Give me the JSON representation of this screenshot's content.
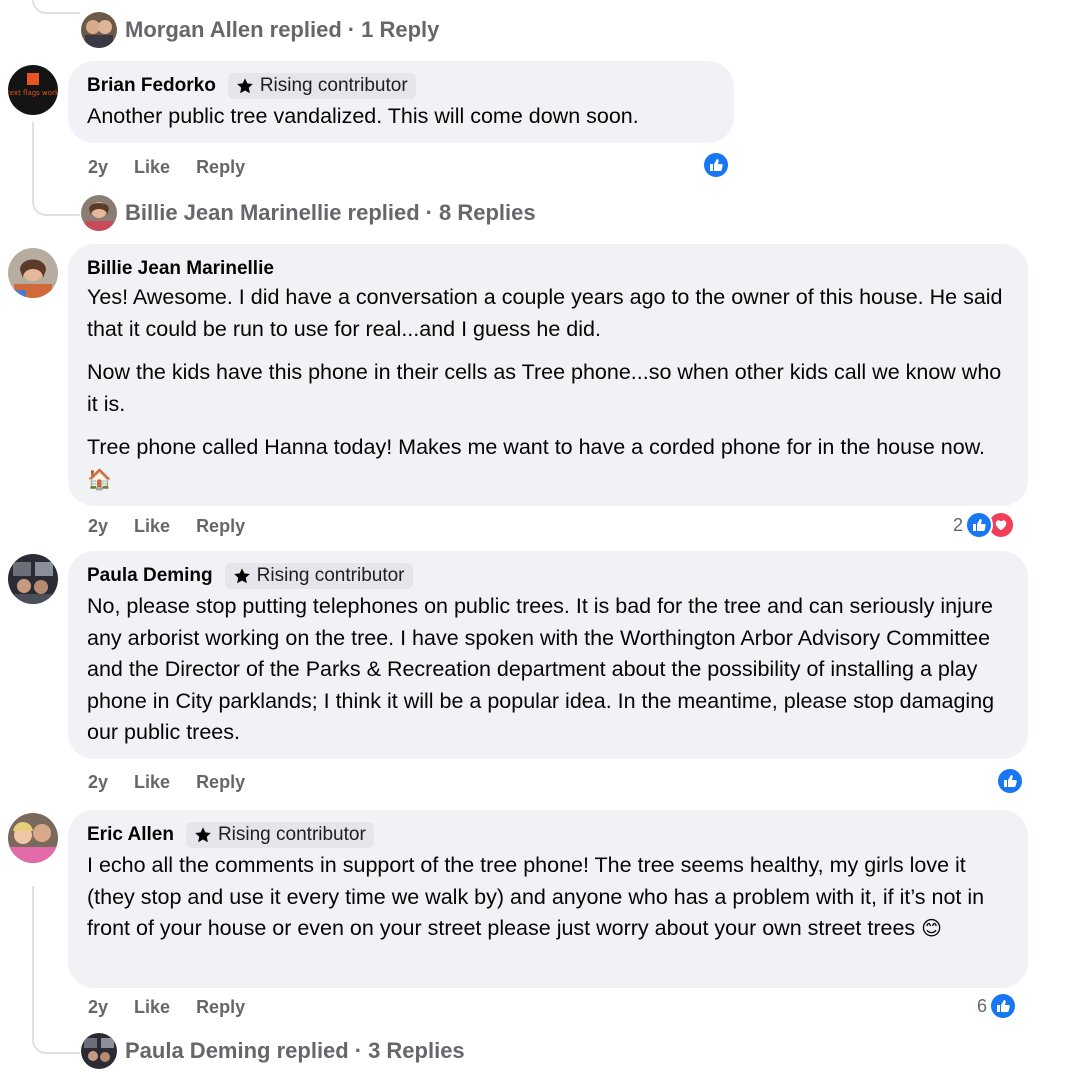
{
  "threads": {
    "morgan": {
      "replied": "Morgan Allen replied",
      "count": "1 Reply"
    },
    "billie": {
      "replied": "Billie Jean Marinellie replied",
      "count": "8 Replies"
    },
    "paula": {
      "replied": "Paula Deming replied",
      "count": "3 Replies"
    }
  },
  "separator": "·",
  "comments": [
    {
      "author": "Brian Fedorko",
      "badge": "Rising contributor",
      "avatar_text": "text flags work",
      "paragraphs": [
        "Another public tree vandalized. This will come down soon."
      ],
      "time": "2y",
      "like": "Like",
      "reply": "Reply",
      "reaction_count": ""
    },
    {
      "author": "Billie Jean Marinellie",
      "paragraphs": [
        "Yes! Awesome. I did have a conversation a couple years ago to the owner of this house. He said that it could be run to use for real...and I guess he did.",
        "Now the kids have this phone in their cells as Tree phone...so when other kids call we know who it is.",
        "Tree phone called Hanna today! Makes me want to have a corded phone for in the house now."
      ],
      "emoji": "🏠",
      "time": "2y",
      "like": "Like",
      "reply": "Reply",
      "reaction_count": "2"
    },
    {
      "author": "Paula Deming",
      "badge": "Rising contributor",
      "paragraphs": [
        "No, please stop putting telephones on public trees. It is bad for the tree and can seriously injure any arborist working on the tree. I have spoken with the Worthington Arbor Advisory Committee and the Director of the Parks & Recreation department about the possibility of installing a play phone in City parklands; I think it will be a popular idea. In the meantime, please stop damaging our public trees."
      ],
      "time": "2y",
      "like": "Like",
      "reply": "Reply",
      "reaction_count": ""
    },
    {
      "author": "Eric Allen",
      "badge": "Rising contributor",
      "paragraphs": [
        "I echo all the comments in support of the tree phone! The tree seems healthy, my girls love it (they stop and use it every time we walk by) and anyone who has a problem with it, if it’s not in front of your house or even on your street please just worry about your own street trees"
      ],
      "emoji": "😊",
      "time": "2y",
      "like": "Like",
      "reply": "Reply",
      "reaction_count": "6"
    }
  ],
  "colors": {
    "bubble": "#f0f2f5",
    "like_blue": "#1877f2",
    "love_red": "#f33e58",
    "muted_text": "#65676b"
  }
}
